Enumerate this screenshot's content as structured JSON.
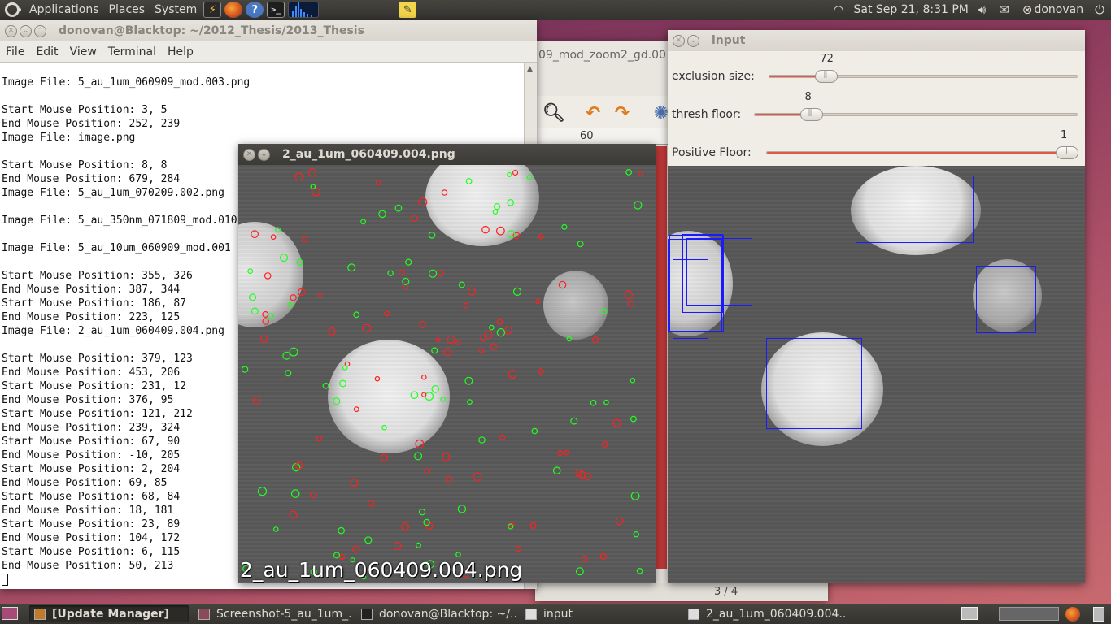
{
  "top_panel": {
    "menus": [
      "Applications",
      "Places",
      "System"
    ],
    "datetime": "Sat Sep 21,  8:31 PM",
    "user": "donovan",
    "icons": [
      "ubuntu-logo-icon",
      "system-monitor-icon",
      "firefox-icon",
      "help-icon",
      "terminal-icon",
      "sysmon-graph-icon",
      "notes-icon",
      "wifi-icon",
      "volume-icon",
      "mail-icon",
      "user-icon",
      "power-icon"
    ]
  },
  "terminal": {
    "title": "donovan@Blacktop: ~/2012_Thesis/2013_Thesis",
    "menus": [
      "File",
      "Edit",
      "View",
      "Terminal",
      "Help"
    ],
    "lines": [
      "Image File: 5_au_1um_060909_mod.003.png",
      "",
      "Start Mouse Position: 3, 5",
      "End Mouse Position: 252, 239",
      "Image File: image.png",
      "",
      "Start Mouse Position: 8, 8",
      "End Mouse Position: 679, 284",
      "Image File: 5_au_1um_070209.002.png",
      "",
      "Image File: 5_au_350nm_071809_mod.010",
      "",
      "Image File: 5_au_10um_060909_mod.001",
      "",
      "Start Mouse Position: 355, 326",
      "End Mouse Position: 387, 344",
      "Start Mouse Position: 186, 87",
      "End Mouse Position: 223, 125",
      "Image File: 2_au_1um_060409.004.png",
      "",
      "Start Mouse Position: 379, 123",
      "End Mouse Position: 453, 206",
      "Start Mouse Position: 231, 12",
      "End Mouse Position: 376, 95",
      "Start Mouse Position: 121, 212",
      "End Mouse Position: 239, 324",
      "Start Mouse Position: 67, 90",
      "End Mouse Position: -10, 205",
      "Start Mouse Position: 2, 204",
      "End Mouse Position: 69, 85",
      "Start Mouse Position: 68, 84",
      "End Mouse Position: 18, 181",
      "Start Mouse Position: 23, 89",
      "End Mouse Position: 104, 172",
      "Start Mouse Position: 6, 115",
      "End Mouse Position: 50, 213"
    ]
  },
  "particle_window": {
    "title": "2_au_1um_060409.004.png",
    "overlay_text": "2_au_1um_060409.004.png"
  },
  "input_window": {
    "title": "input",
    "sliders": [
      {
        "label": "exclusion size:",
        "value": "72",
        "fraction": 0.16
      },
      {
        "label": "thresh floor:",
        "value": "8",
        "fraction": 0.15
      },
      {
        "label": "Positive Floor:",
        "value": "1",
        "fraction": 1.0
      }
    ]
  },
  "viewer_window": {
    "title_fragment": "09_mod_zoom2_gd.00",
    "ruler_tick": "60",
    "page_counter": "3 / 4"
  },
  "taskbar": {
    "tasks": [
      {
        "label": "[Update Manager]",
        "active": true
      },
      {
        "label": "Screenshot-5_au_1um_...",
        "active": false
      },
      {
        "label": "donovan@Blacktop: ~/...",
        "active": false
      },
      {
        "label": "input",
        "active": false
      },
      {
        "label": "2_au_1um_060409.004....",
        "active": false
      }
    ]
  },
  "colors": {
    "panel": "#3b3a36",
    "terminal_bg": "#ffffff",
    "accent_slider": "#e2584a",
    "detection_red": "#ff2020",
    "detection_green": "#20ff20",
    "bbox_blue": "#1a1aff"
  }
}
